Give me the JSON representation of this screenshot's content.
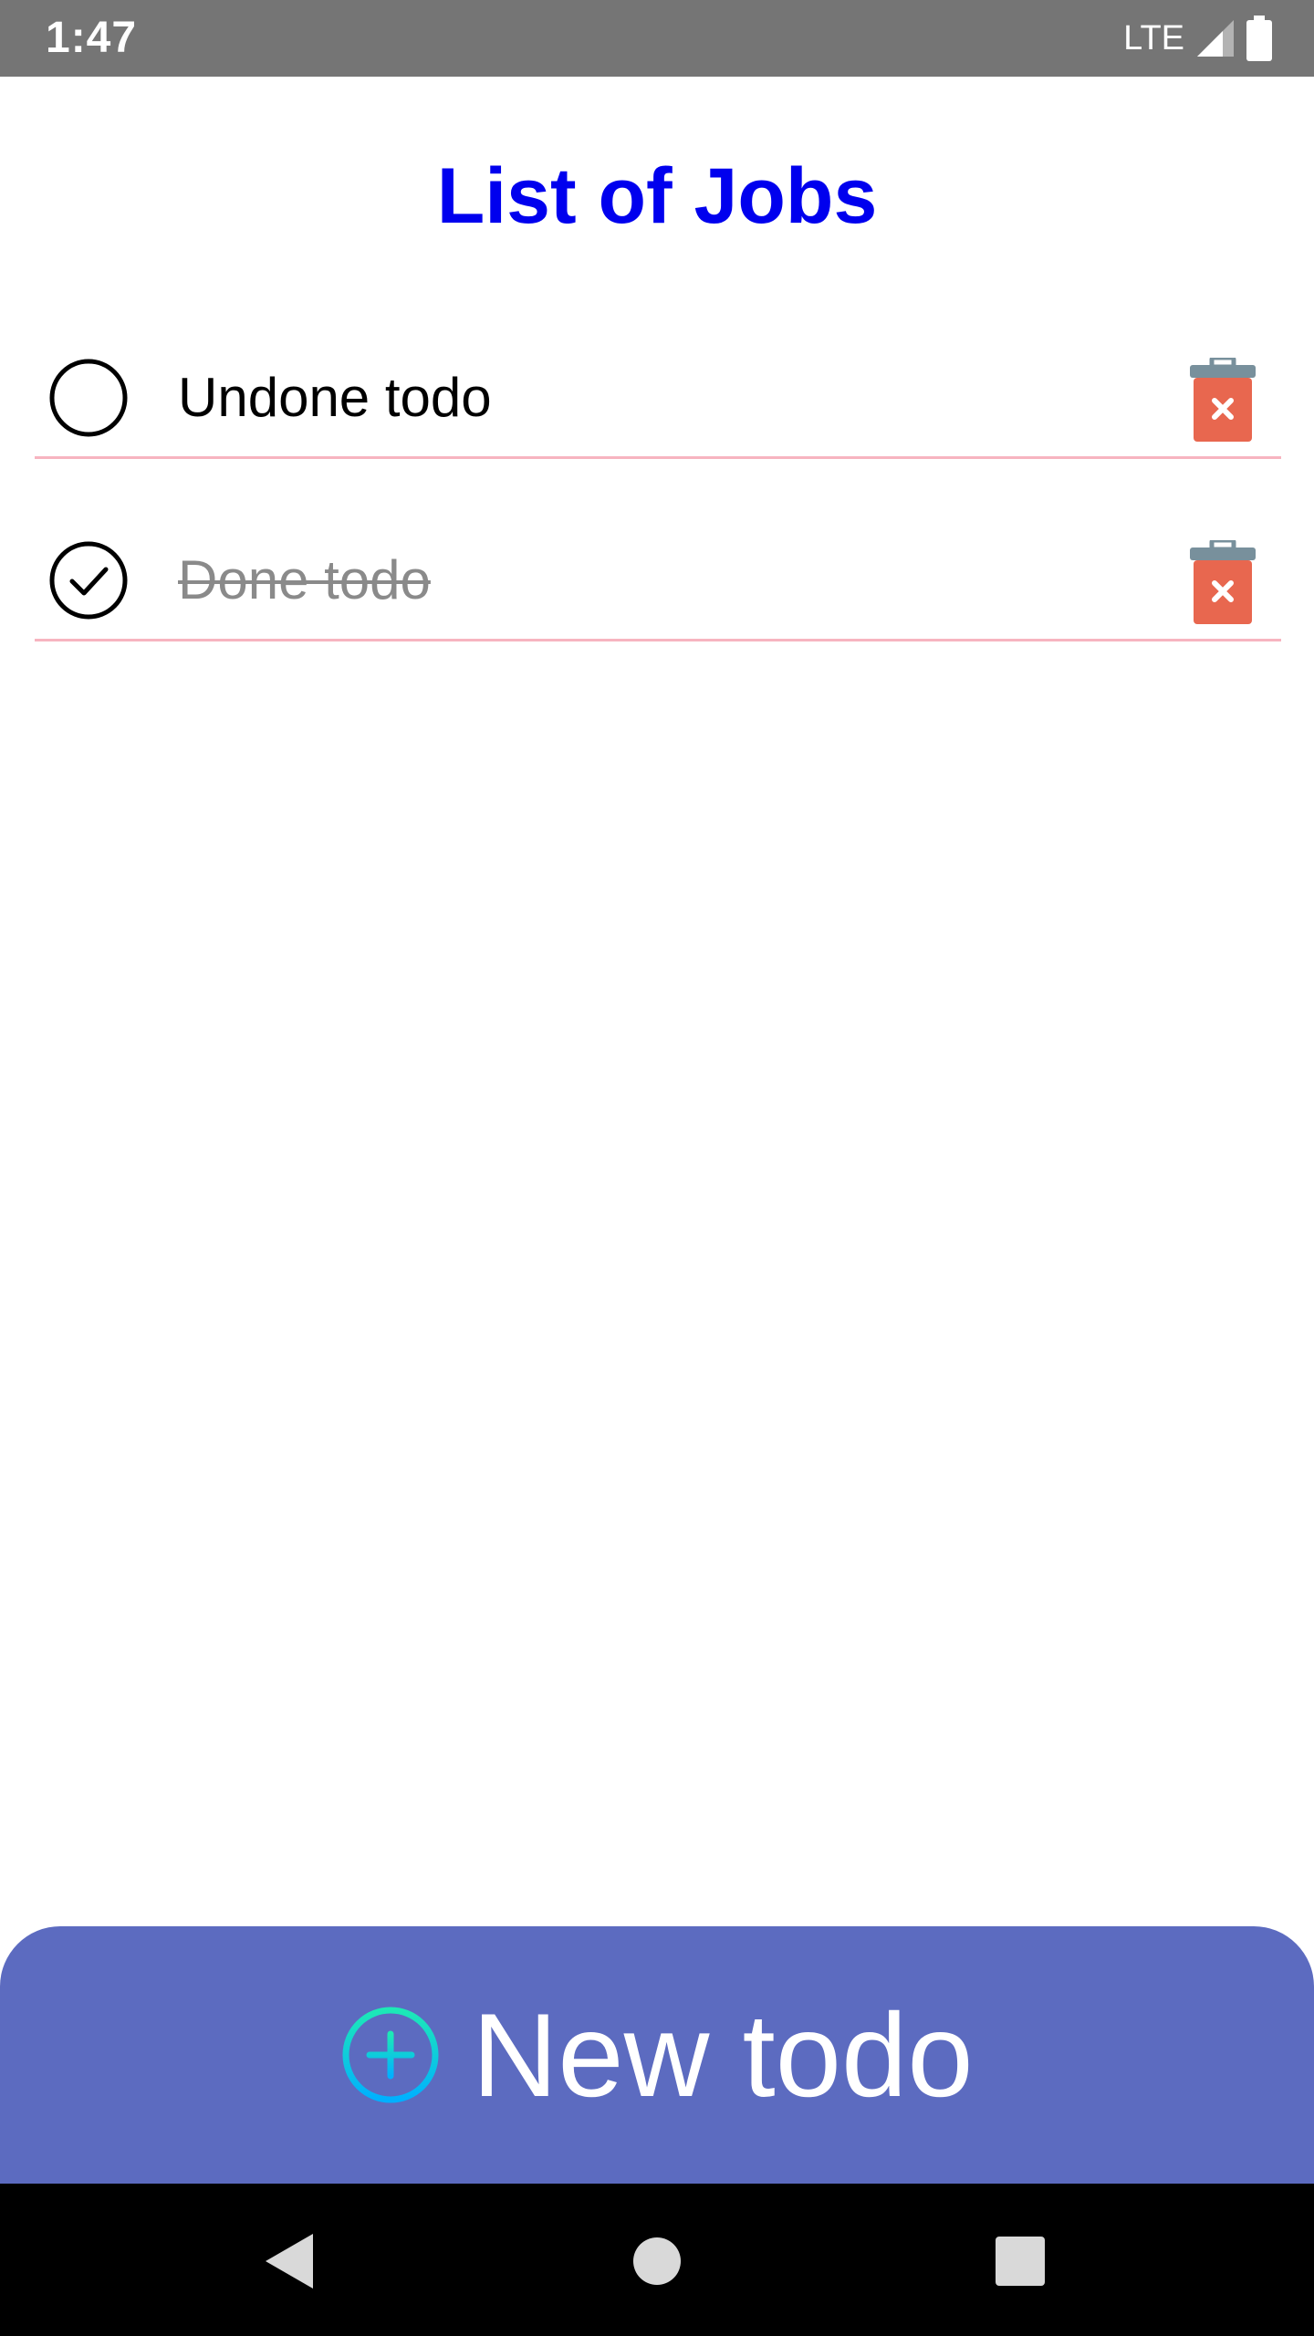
{
  "status_bar": {
    "time": "1:47",
    "network": "LTE"
  },
  "page": {
    "title": "List of Jobs"
  },
  "todos": [
    {
      "text": "Undone todo",
      "done": false
    },
    {
      "text": "Done todo",
      "done": true
    }
  ],
  "new_todo": {
    "label": "New todo"
  },
  "colors": {
    "title": "#0000ee",
    "divider": "#f7b4c0",
    "new_todo_bar": "#5c6bc0",
    "trash_body": "#e8674f",
    "trash_lid": "#78909c"
  },
  "icons": {
    "status": [
      "signal-icon",
      "battery-icon"
    ],
    "todo_check_undone": "circle-outline-icon",
    "todo_check_done": "check-circle-icon",
    "todo_delete": "trash-icon",
    "new_todo": "plus-circle-icon",
    "nav": [
      "back-icon",
      "home-icon",
      "recents-icon"
    ]
  }
}
